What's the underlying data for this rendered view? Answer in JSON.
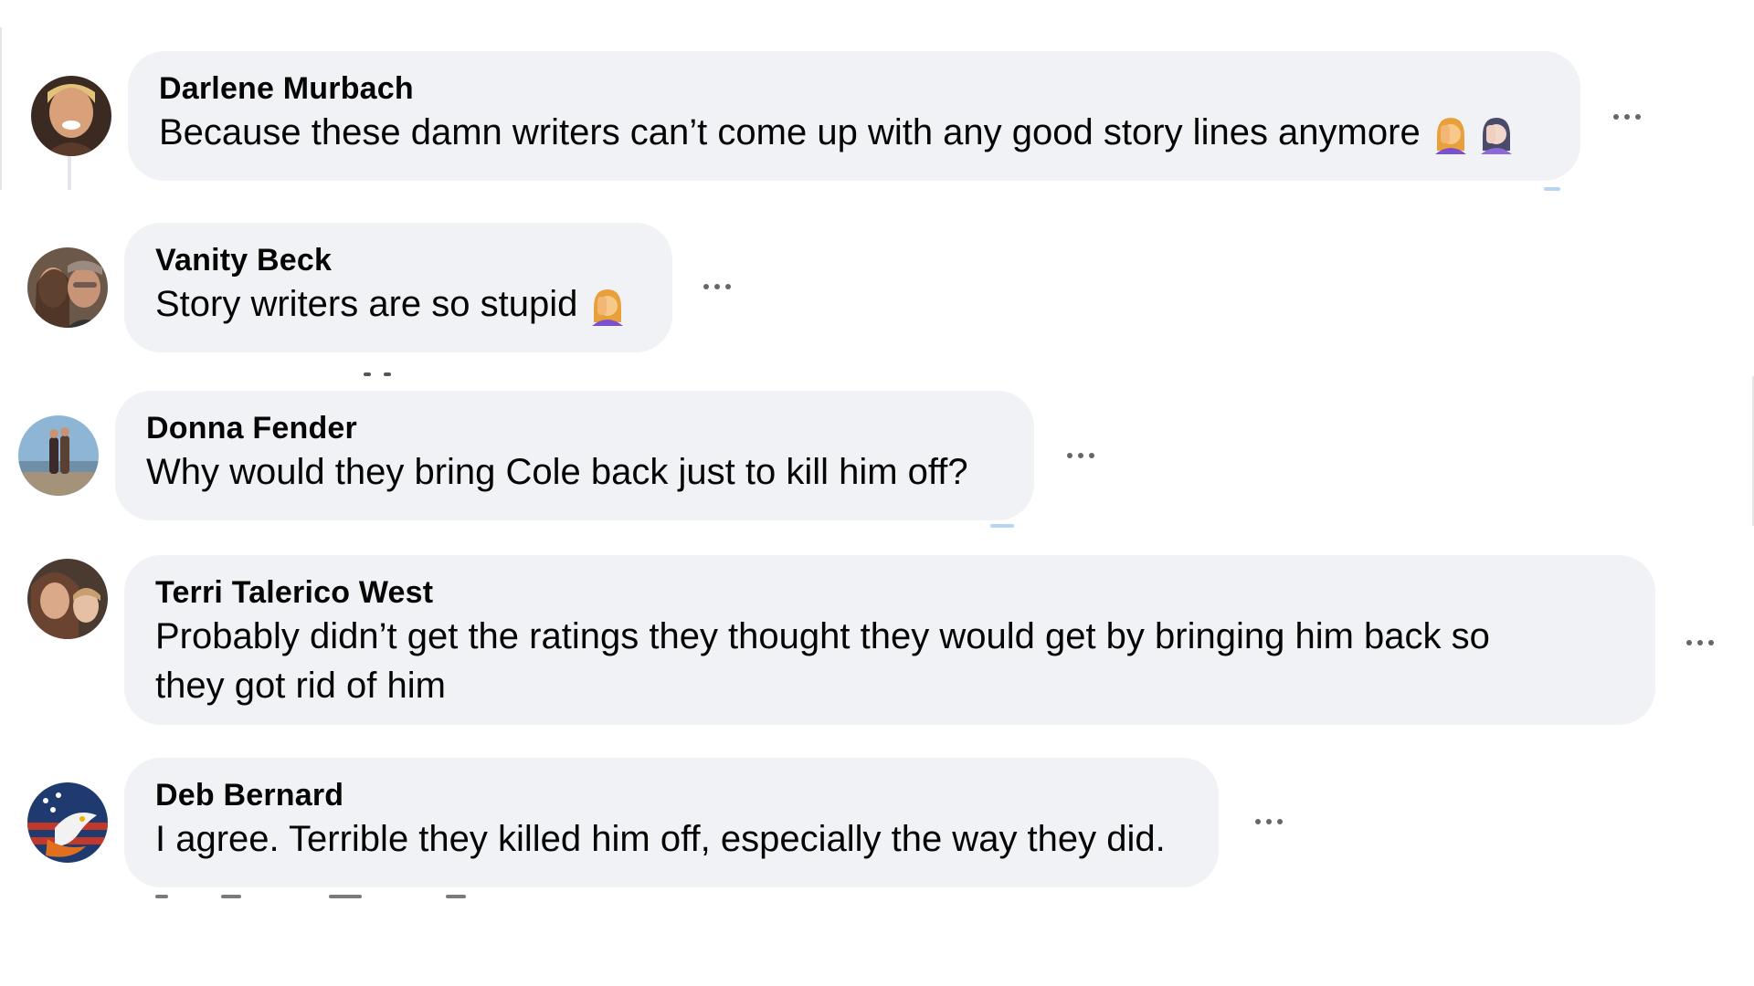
{
  "comments": [
    {
      "author": "Darlene Murbach",
      "text": "Because these damn writers can’t come up with any good story lines anymore",
      "emojis": [
        "woman-facepalming-icon",
        "woman-facepalming-icon"
      ],
      "avatar": "avatar-photo"
    },
    {
      "author": "Vanity Beck",
      "text": "Story writers are so stupid",
      "emojis": [
        "woman-facepalming-icon"
      ],
      "avatar": "avatar-photo"
    },
    {
      "author": "Donna Fender",
      "text": "Why would they bring Cole back just to kill him off?",
      "emojis": [],
      "avatar": "avatar-photo"
    },
    {
      "author": "Terri Talerico West",
      "text_line1": "Probably didn’t get the ratings they thought they would get by bringing him back so",
      "text_line2": "they got rid of him",
      "emojis": [],
      "avatar": "avatar-photo"
    },
    {
      "author": "Deb Bernard",
      "text": "I agree. Terrible they killed him off, especially the way they did.",
      "emojis": [],
      "avatar": "avatar-eagle-flag"
    }
  ],
  "icons": {
    "more": "more-options-icon",
    "emoji": "woman-facepalming-icon"
  },
  "colors": {
    "bubble": "#f0f2f5",
    "text": "#050505",
    "secondary": "#65676b"
  }
}
